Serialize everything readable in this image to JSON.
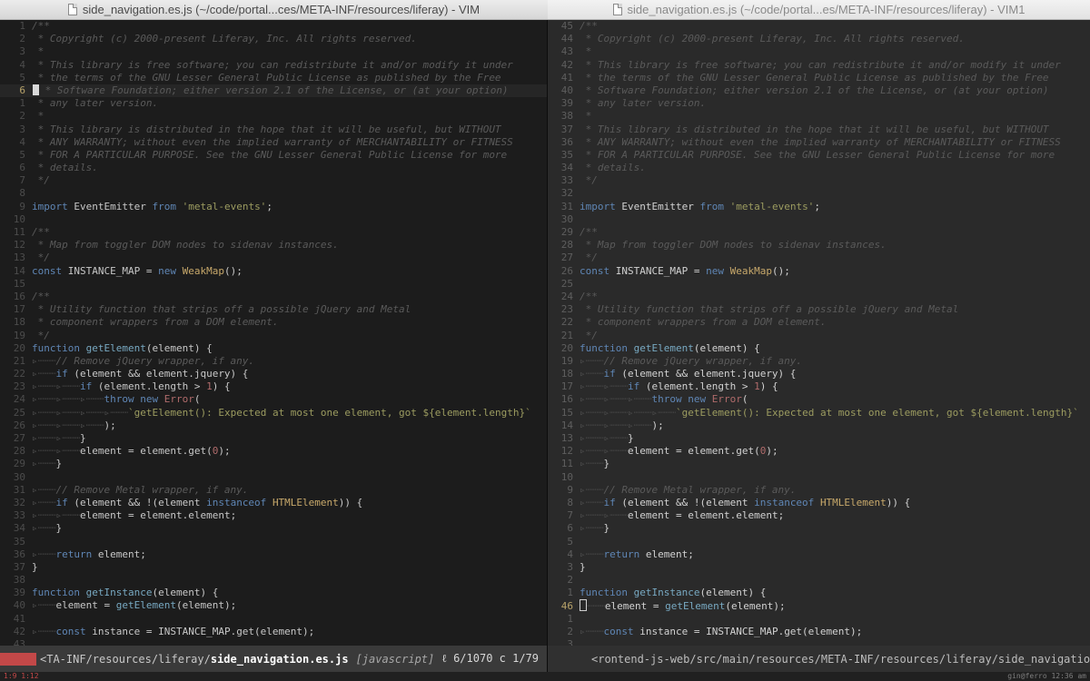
{
  "left_window": {
    "title": "side_navigation.es.js (~/code/portal...ces/META-INF/resources/liferay) - VIM",
    "status": {
      "path_prefix": "<TA-INF/resources/liferay/",
      "filename": "side_navigation.es.js",
      "filetype": "[javascript]",
      "position": "ℓ 6/1070 c 1/79"
    },
    "lines": [
      {
        "n": "1",
        "t": "/**"
      },
      {
        "n": "2",
        "t": " * Copyright (c) 2000-present Liferay, Inc. All rights reserved."
      },
      {
        "n": "3",
        "t": " *"
      },
      {
        "n": "4",
        "t": " * This library is free software; you can redistribute it and/or modify it under"
      },
      {
        "n": "5",
        "t": " * the terms of the GNU Lesser General Public License as published by the Free"
      },
      {
        "n": "6",
        "t": " * Software Foundation; either version 2.1 of the License, or (at your option)"
      },
      {
        "n": "1",
        "t": " * any later version."
      },
      {
        "n": "2",
        "t": " *"
      },
      {
        "n": "3",
        "t": " * This library is distributed in the hope that it will be useful, but WITHOUT"
      },
      {
        "n": "4",
        "t": " * ANY WARRANTY; without even the implied warranty of MERCHANTABILITY or FITNESS"
      },
      {
        "n": "5",
        "t": " * FOR A PARTICULAR PURPOSE. See the GNU Lesser General Public License for more"
      },
      {
        "n": "6",
        "t": " * details."
      },
      {
        "n": "7",
        "t": " */"
      },
      {
        "n": "8",
        "t": ""
      },
      {
        "n": "9",
        "t": "import EventEmitter from 'metal-events';"
      },
      {
        "n": "10",
        "t": ""
      },
      {
        "n": "11",
        "t": "/**"
      },
      {
        "n": "12",
        "t": " * Map from toggler DOM nodes to sidenav instances."
      },
      {
        "n": "13",
        "t": " */"
      },
      {
        "n": "14",
        "t": "const INSTANCE_MAP = new WeakMap();"
      },
      {
        "n": "15",
        "t": ""
      },
      {
        "n": "16",
        "t": "/**"
      },
      {
        "n": "17",
        "t": " * Utility function that strips off a possible jQuery and Metal"
      },
      {
        "n": "18",
        "t": " * component wrappers from a DOM element."
      },
      {
        "n": "19",
        "t": " */"
      },
      {
        "n": "20",
        "t": "function getElement(element) {"
      },
      {
        "n": "21",
        "t": "\t// Remove jQuery wrapper, if any."
      },
      {
        "n": "22",
        "t": "\tif (element && element.jquery) {"
      },
      {
        "n": "23",
        "t": "\t\tif (element.length > 1) {"
      },
      {
        "n": "24",
        "t": "\t\t\tthrow new Error("
      },
      {
        "n": "25",
        "t": "\t\t\t\t`getElement(): Expected at most one element, got ${element.length}`"
      },
      {
        "n": "26",
        "t": "\t\t\t);"
      },
      {
        "n": "27",
        "t": "\t\t}"
      },
      {
        "n": "28",
        "t": "\t\telement = element.get(0);"
      },
      {
        "n": "29",
        "t": "\t}"
      },
      {
        "n": "30",
        "t": ""
      },
      {
        "n": "31",
        "t": "\t// Remove Metal wrapper, if any."
      },
      {
        "n": "32",
        "t": "\tif (element && !(element instanceof HTMLElement)) {"
      },
      {
        "n": "33",
        "t": "\t\telement = element.element;"
      },
      {
        "n": "34",
        "t": "\t}"
      },
      {
        "n": "35",
        "t": ""
      },
      {
        "n": "36",
        "t": "\treturn element;"
      },
      {
        "n": "37",
        "t": "}"
      },
      {
        "n": "38",
        "t": ""
      },
      {
        "n": "39",
        "t": "function getInstance(element) {"
      },
      {
        "n": "40",
        "t": "\telement = getElement(element);"
      },
      {
        "n": "41",
        "t": ""
      },
      {
        "n": "42",
        "t": "\tconst instance = INSTANCE_MAP.get(element);"
      },
      {
        "n": "43",
        "t": ""
      }
    ]
  },
  "right_window": {
    "title": "side_navigation.es.js (~/code/portal...es/META-INF/resources/liferay) - VIM1",
    "status": {
      "path_prefix": "<rontend-js-web/src/main/resources/META-INF/resources/liferay/side_navigation.es.js"
    },
    "lines": [
      {
        "n": "45",
        "t": "/**"
      },
      {
        "n": "44",
        "t": " * Copyright (c) 2000-present Liferay, Inc. All rights reserved."
      },
      {
        "n": "43",
        "t": " *"
      },
      {
        "n": "42",
        "t": " * This library is free software; you can redistribute it and/or modify it under"
      },
      {
        "n": "41",
        "t": " * the terms of the GNU Lesser General Public License as published by the Free"
      },
      {
        "n": "40",
        "t": " * Software Foundation; either version 2.1 of the License, or (at your option)"
      },
      {
        "n": "39",
        "t": " * any later version."
      },
      {
        "n": "38",
        "t": " *"
      },
      {
        "n": "37",
        "t": " * This library is distributed in the hope that it will be useful, but WITHOUT"
      },
      {
        "n": "36",
        "t": " * ANY WARRANTY; without even the implied warranty of MERCHANTABILITY or FITNESS"
      },
      {
        "n": "35",
        "t": " * FOR A PARTICULAR PURPOSE. See the GNU Lesser General Public License for more"
      },
      {
        "n": "34",
        "t": " * details."
      },
      {
        "n": "33",
        "t": " */"
      },
      {
        "n": "32",
        "t": ""
      },
      {
        "n": "31",
        "t": "import EventEmitter from 'metal-events';"
      },
      {
        "n": "30",
        "t": ""
      },
      {
        "n": "29",
        "t": "/**"
      },
      {
        "n": "28",
        "t": " * Map from toggler DOM nodes to sidenav instances."
      },
      {
        "n": "27",
        "t": " */"
      },
      {
        "n": "26",
        "t": "const INSTANCE_MAP = new WeakMap();"
      },
      {
        "n": "25",
        "t": ""
      },
      {
        "n": "24",
        "t": "/**"
      },
      {
        "n": "23",
        "t": " * Utility function that strips off a possible jQuery and Metal"
      },
      {
        "n": "22",
        "t": " * component wrappers from a DOM element."
      },
      {
        "n": "21",
        "t": " */"
      },
      {
        "n": "20",
        "t": "function getElement(element) {"
      },
      {
        "n": "19",
        "t": "\t// Remove jQuery wrapper, if any."
      },
      {
        "n": "18",
        "t": "\tif (element && element.jquery) {"
      },
      {
        "n": "17",
        "t": "\t\tif (element.length > 1) {"
      },
      {
        "n": "16",
        "t": "\t\t\tthrow new Error("
      },
      {
        "n": "15",
        "t": "\t\t\t\t`getElement(): Expected at most one element, got ${element.length}`"
      },
      {
        "n": "14",
        "t": "\t\t\t);"
      },
      {
        "n": "13",
        "t": "\t\t}"
      },
      {
        "n": "12",
        "t": "\t\telement = element.get(0);"
      },
      {
        "n": "11",
        "t": "\t}"
      },
      {
        "n": "10",
        "t": ""
      },
      {
        "n": "9",
        "t": "\t// Remove Metal wrapper, if any."
      },
      {
        "n": "8",
        "t": "\tif (element && !(element instanceof HTMLElement)) {"
      },
      {
        "n": "7",
        "t": "\t\telement = element.element;"
      },
      {
        "n": "6",
        "t": "\t}"
      },
      {
        "n": "5",
        "t": ""
      },
      {
        "n": "4",
        "t": "\treturn element;"
      },
      {
        "n": "3",
        "t": "}"
      },
      {
        "n": "2",
        "t": ""
      },
      {
        "n": "1",
        "t": "function getInstance(element) {"
      },
      {
        "n": "46",
        "t": "\telement = getElement(element);"
      },
      {
        "n": "1",
        "t": ""
      },
      {
        "n": "2",
        "t": "\tconst instance = INSTANCE_MAP.get(element);"
      },
      {
        "n": "3",
        "t": ""
      }
    ]
  },
  "bottom_strip": {
    "left": "1:9 1:12",
    "right": "gin@ferro 12:36 am"
  }
}
